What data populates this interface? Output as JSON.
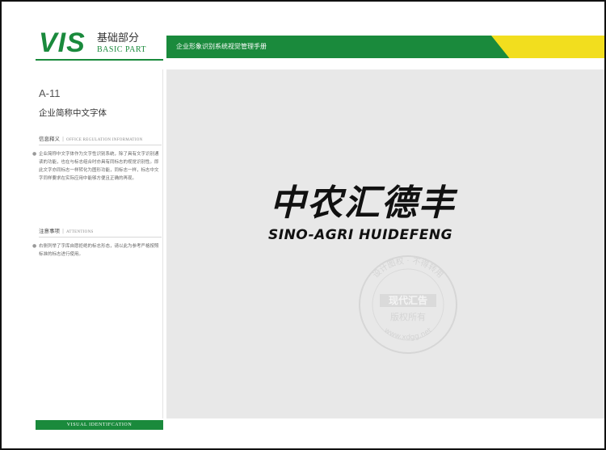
{
  "section": {
    "logo_mark": "VIS",
    "label_cn": "基础部分",
    "label_en": "BASIC PART"
  },
  "header": {
    "title": "企业形象识别系统视觉管理手册"
  },
  "sidebar": {
    "code": "A-11",
    "subtitle": "企业简称中文字体",
    "info": {
      "heading_cn": "信息释义",
      "heading_en": "OFFICE REGULATION INFORMATION",
      "bullet": "●",
      "body": "企业简称中文字体作为文字性识别系统，除了具有文字识别通读的功能，也在与标志组合时亦具有同标志的视觉识别性。即此文字亦同标志一样转化为图形功能，同标志一样，标志中文字同样要求在实际应用中能够方便且正确的再现。"
    },
    "notes": {
      "heading_cn": "注意事项",
      "heading_en": "ATTENTIONS",
      "bullet": "●",
      "body": "右侧列举了字库自愿拒绝的标志形态，请以此为参考严格按照标准的标志进行使用。"
    },
    "footer": "VISUAL IDENTIFCATION"
  },
  "brand": {
    "name_cn": "中农汇德丰",
    "name_en": "SINO-AGRI HUIDEFENG"
  },
  "watermark": {
    "top_text": "设计图权 · 不得转用",
    "middle_text": "现代汇告",
    "lower_text": "版权所有",
    "bottom_text": "www.xdgg.net"
  },
  "colors": {
    "green": "#1a8a3c",
    "yellow": "#f2de1e",
    "panel": "#e8e8e8"
  }
}
